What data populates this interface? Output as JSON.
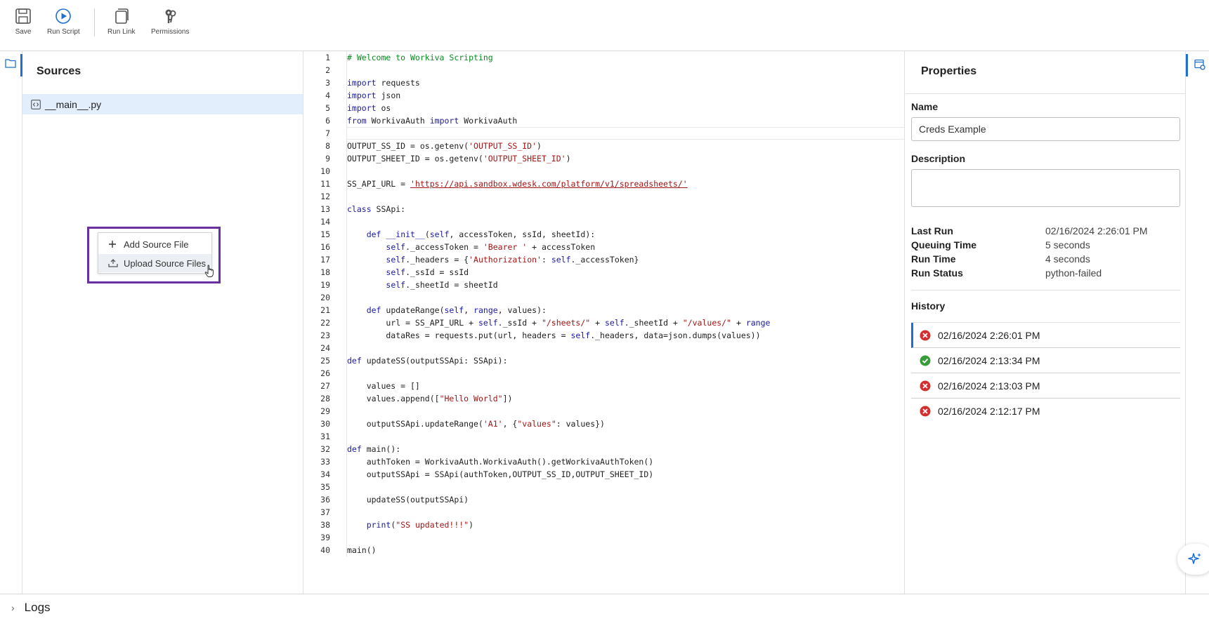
{
  "toolbar": {
    "save": "Save",
    "run_script": "Run Script",
    "run_link": "Run Link",
    "permissions": "Permissions"
  },
  "sources": {
    "title": "Sources",
    "files": [
      "__main__.py"
    ],
    "context_menu": {
      "add": "Add Source File",
      "upload": "Upload Source Files"
    }
  },
  "editor": {
    "current_line": 7,
    "lines": [
      "# Welcome to Workiva Scripting",
      "",
      "import requests",
      "import json",
      "import os",
      "from WorkivaAuth import WorkivaAuth",
      "",
      "OUTPUT_SS_ID = os.getenv('OUTPUT_SS_ID')",
      "OUTPUT_SHEET_ID = os.getenv('OUTPUT_SHEET_ID')",
      "",
      "SS_API_URL = 'https://api.sandbox.wdesk.com/platform/v1/spreadsheets/'",
      "",
      "class SSApi:",
      "",
      "    def __init__(self, accessToken, ssId, sheetId):",
      "        self._accessToken = 'Bearer ' + accessToken",
      "        self._headers = {'Authorization': self._accessToken}",
      "        self._ssId = ssId",
      "        self._sheetId = sheetId",
      "",
      "    def updateRange(self, range, values):",
      "        url = SS_API_URL + self._ssId + \"/sheets/\" + self._sheetId + \"/values/\" + range",
      "        dataRes = requests.put(url, headers = self._headers, data=json.dumps(values))",
      "",
      "def updateSS(outputSSApi: SSApi):",
      "",
      "    values = []",
      "    values.append([\"Hello World\"])",
      "",
      "    outputSSApi.updateRange('A1', {\"values\": values})",
      "",
      "def main():",
      "    authToken = WorkivaAuth.WorkivaAuth().getWorkivaAuthToken()",
      "    outputSSApi = SSApi(authToken,OUTPUT_SS_ID,OUTPUT_SHEET_ID)",
      "",
      "    updateSS(outputSSApi)",
      "",
      "    print(\"SS updated!!!\")",
      "",
      "main()"
    ]
  },
  "properties": {
    "title": "Properties",
    "name_label": "Name",
    "name_value": "Creds Example",
    "description_label": "Description",
    "description_value": "",
    "stats": [
      {
        "label": "Last Run",
        "value": "02/16/2024 2:26:01 PM"
      },
      {
        "label": "Queuing Time",
        "value": "5 seconds"
      },
      {
        "label": "Run Time",
        "value": "4 seconds"
      },
      {
        "label": "Run Status",
        "value": "python-failed"
      }
    ],
    "history_label": "History",
    "history": [
      {
        "time": "02/16/2024 2:26:01 PM",
        "status": "failed",
        "selected": true
      },
      {
        "time": "02/16/2024 2:13:34 PM",
        "status": "success",
        "selected": false
      },
      {
        "time": "02/16/2024 2:13:03 PM",
        "status": "failed",
        "selected": false
      },
      {
        "time": "02/16/2024 2:12:17 PM",
        "status": "failed",
        "selected": false
      }
    ]
  },
  "logs": {
    "label": "Logs"
  },
  "colors": {
    "accent": "#1f6fd1",
    "selection_outline": "#6b2fa0",
    "error": "#d32f2f",
    "success": "#3a9b3a"
  }
}
